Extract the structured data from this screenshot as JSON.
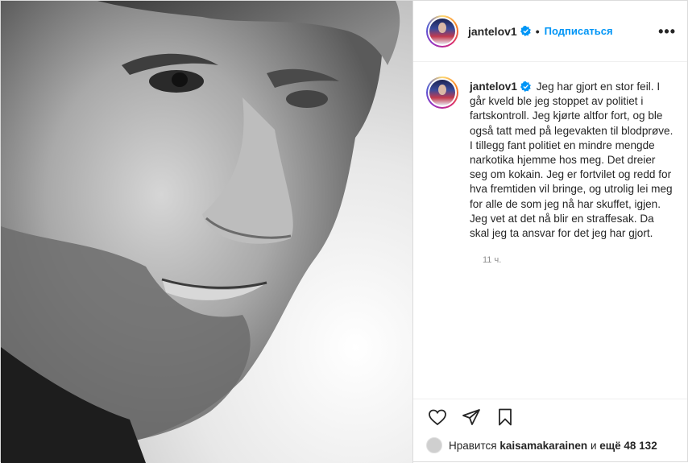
{
  "post": {
    "username": "jantelov1",
    "follow_label": "Подписаться",
    "separator": "•",
    "more_label": "•••",
    "caption": "Jeg har gjort en stor feil. I går kveld ble jeg stoppet av politiet i fartskontroll. Jeg kjørte altfor fort, og ble også tatt med på legevakten til blodprøve. I tillegg fant politiet en mindre mengde narkotika hjemme hos meg. Det dreier seg om kokain. Jeg er fortvilet og redd for hva fremtiden vil bringe, og utrolig lei meg for alle de som jeg nå har skuffet, igjen. Jeg vet at det nå blir en straffesak. Da skal jeg ta ansvar for det jeg har gjort.",
    "time_ago": "11 ч.",
    "likes": {
      "prefix": "Нравится",
      "liker": "kaisamakarainen",
      "connector": "и",
      "others": "ещё 48 132"
    }
  },
  "icons": {
    "verified": "verified-badge-icon",
    "like": "heart-icon",
    "share": "paper-plane-icon",
    "save": "bookmark-icon"
  },
  "colors": {
    "accent": "#0095f6",
    "text": "#262626",
    "muted": "#8e8e8e"
  }
}
